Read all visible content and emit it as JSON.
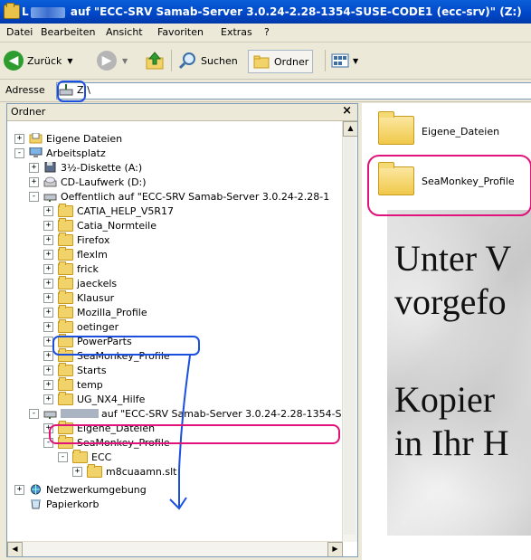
{
  "window": {
    "title_prefix": "L",
    "title": "auf \"ECC-SRV Samab-Server 3.0.24-2.28-1354-SUSE-CODE1 (ecc-srv)\" (Z:)"
  },
  "menu": [
    "Datei",
    "Bearbeiten",
    "Ansicht",
    "Favoriten",
    "Extras",
    "?"
  ],
  "toolbar": {
    "back": "Zurück",
    "search": "Suchen",
    "folders": "Ordner"
  },
  "address": {
    "label": "Adresse",
    "value": "Z:\\"
  },
  "folder_pane": {
    "title": "Ordner",
    "close": "×"
  },
  "tree": [
    {
      "label": "Eigene Dateien",
      "icon": "documents-icon",
      "pm": "+"
    },
    {
      "label": "Arbeitsplatz",
      "icon": "computer-icon",
      "pm": "-"
    },
    {
      "label": "3½-Diskette (A:)",
      "icon": "floppy-icon",
      "pm": "+"
    },
    {
      "label": "CD-Laufwerk (D:)",
      "icon": "cd-drive-icon",
      "pm": "+"
    },
    {
      "label": "Oeffentlich auf \"ECC-SRV Samab-Server 3.0.24-2.28-1",
      "icon": "network-drive-icon",
      "pm": "-"
    },
    {
      "label": "CATIA_HELP_V5R17",
      "icon": "folder-icon",
      "pm": "+"
    },
    {
      "label": "Catia_Normteile",
      "icon": "folder-icon",
      "pm": "+"
    },
    {
      "label": "Firefox",
      "icon": "folder-icon",
      "pm": "+"
    },
    {
      "label": "flexlm",
      "icon": "folder-icon",
      "pm": "+"
    },
    {
      "label": "frick",
      "icon": "folder-icon",
      "pm": "+"
    },
    {
      "label": "jaeckels",
      "icon": "folder-icon",
      "pm": "+"
    },
    {
      "label": "Klausur",
      "icon": "folder-icon",
      "pm": "+"
    },
    {
      "label": "Mozilla_Profile",
      "icon": "folder-icon",
      "pm": "+"
    },
    {
      "label": "oetinger",
      "icon": "folder-icon",
      "pm": "+"
    },
    {
      "label": "PowerParts",
      "icon": "folder-icon",
      "pm": "+"
    },
    {
      "label": "SeaMonkey_Profile",
      "icon": "folder-icon",
      "pm": "+"
    },
    {
      "label": "Starts",
      "icon": "folder-icon",
      "pm": "+"
    },
    {
      "label": "temp",
      "icon": "folder-icon",
      "pm": "+"
    },
    {
      "label": "UG_NX4_Hilfe",
      "icon": "folder-icon",
      "pm": "+"
    },
    {
      "label": "auf \"ECC-SRV Samab-Server 3.0.24-2.28-1354-S",
      "icon": "network-drive-icon",
      "pm": "-"
    },
    {
      "label": "Eigene_Dateien",
      "icon": "folder-icon",
      "pm": "+"
    },
    {
      "label": "SeaMonkey_Profile",
      "icon": "folder-icon",
      "pm": "-"
    },
    {
      "label": "ECC",
      "icon": "folder-icon",
      "pm": "-"
    },
    {
      "label": "m8cuaamn.slt",
      "icon": "folder-icon",
      "pm": "+"
    },
    {
      "label": "Netzwerkumgebung",
      "icon": "network-icon",
      "pm": "+"
    },
    {
      "label": "Papierkorb",
      "icon": "recycle-bin-icon",
      "pm": ""
    }
  ],
  "files": [
    {
      "label": "Eigene_Dateien"
    },
    {
      "label": "SeaMonkey_Profile"
    }
  ],
  "overlay_text": [
    "Unter V",
    "vorgefo",
    "Kopier",
    "in Ihr H"
  ],
  "colors": {
    "title_bar": "#0046c8",
    "highlight_pink": "#e0137a",
    "highlight_blue": "#1a4fe0"
  }
}
